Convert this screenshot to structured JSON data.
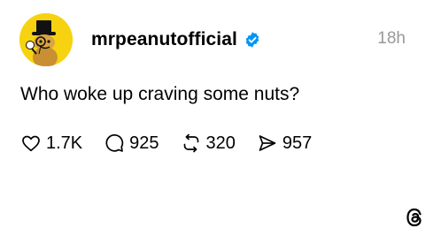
{
  "post": {
    "author": {
      "username": "mrpeanutofficial",
      "verified": true,
      "avatar_icon": "mr-peanut-avatar"
    },
    "timestamp": "18h",
    "text": "Who woke up craving some nuts?",
    "actions": [
      {
        "name": "like",
        "icon": "heart-icon",
        "count": "1.7K"
      },
      {
        "name": "reply",
        "icon": "comment-icon",
        "count": "925"
      },
      {
        "name": "repost",
        "icon": "repost-icon",
        "count": "320"
      },
      {
        "name": "share",
        "icon": "send-icon",
        "count": "957"
      }
    ]
  },
  "branding": {
    "logo_icon": "threads-logo-icon"
  },
  "colors": {
    "avatar_background": "#f7d210",
    "verified_badge": "#0095f6",
    "timestamp": "#999999",
    "text": "#000000"
  }
}
